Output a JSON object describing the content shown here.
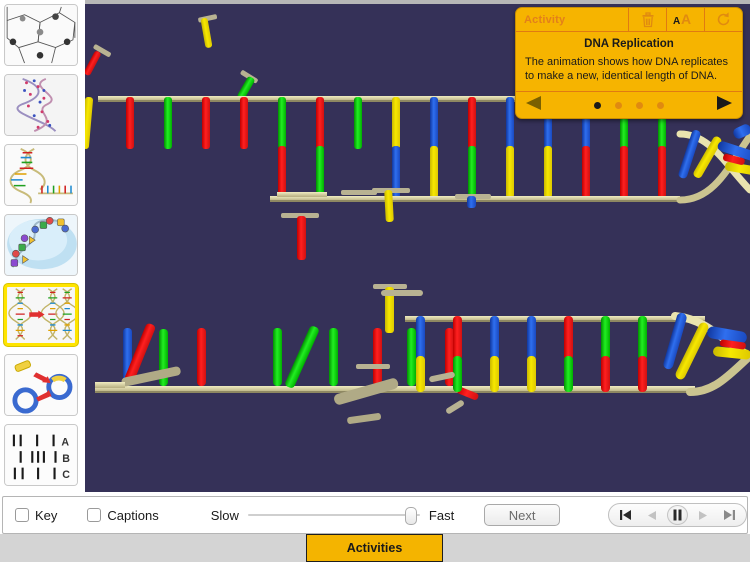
{
  "app": {
    "stage_bg": "#353158",
    "accent": "#f6b400",
    "tab_bar_bg": "#d4d4d4"
  },
  "sidebar": {
    "items": [
      {
        "name": "cells-diagram",
        "label": "Cells",
        "selected": false
      },
      {
        "name": "dna-double-helix",
        "label": "DNA Double Helix",
        "selected": false
      },
      {
        "name": "dna-unzipping",
        "label": "DNA Unzipping",
        "selected": false
      },
      {
        "name": "protein-synthesis",
        "label": "Protein Synthesis",
        "selected": false
      },
      {
        "name": "dna-replication",
        "label": "DNA Replication",
        "selected": true
      },
      {
        "name": "plasmid-insertion",
        "label": "Plasmid Insertion",
        "selected": false
      },
      {
        "name": "dna-fingerprint",
        "label": "DNA Fingerprint",
        "selected": false
      }
    ],
    "fingerprint_rows": [
      "A",
      "B",
      "C"
    ]
  },
  "activity_panel": {
    "title": "Activity",
    "heading": "DNA Replication",
    "text": "The animation shows how DNA replicates to make a new, identical length of DNA.",
    "icons": {
      "delete": "trash-icon",
      "text_size": "text-size-icon",
      "reset": "reset-icon",
      "prev": "prev-arrow-icon",
      "next": "next-arrow-icon"
    },
    "text_size_label": "AA",
    "page_dots": {
      "count": 4,
      "active_index": 0
    },
    "accent_color": "#f6b400",
    "title_color": "#e3801a"
  },
  "toolbar": {
    "key_label": "Key",
    "key_checked": false,
    "captions_label": "Captions",
    "captions_checked": false,
    "speed_min_label": "Slow",
    "speed_max_label": "Fast",
    "speed_value_percent": 97,
    "next_label": "Next",
    "transport": {
      "skip_back": "skip-back-icon",
      "step_back": "step-back-icon",
      "pause": "pause-icon",
      "step_forward": "step-forward-icon",
      "skip_forward": "skip-forward-icon",
      "active": "pause"
    }
  },
  "tabbar": {
    "activities_label": "Activities"
  },
  "stage": {
    "description": "3D animation of DNA replication: two DNA backbones with colored nucleotide bases",
    "base_colors": {
      "adenine": "#ff1a1a",
      "thymine": "#00e000",
      "guanine": "#1e5fe0",
      "cytosine": "#f2e100"
    },
    "backbone_color": "#e8e2a8",
    "backbone_shadow": "#a8a276"
  }
}
